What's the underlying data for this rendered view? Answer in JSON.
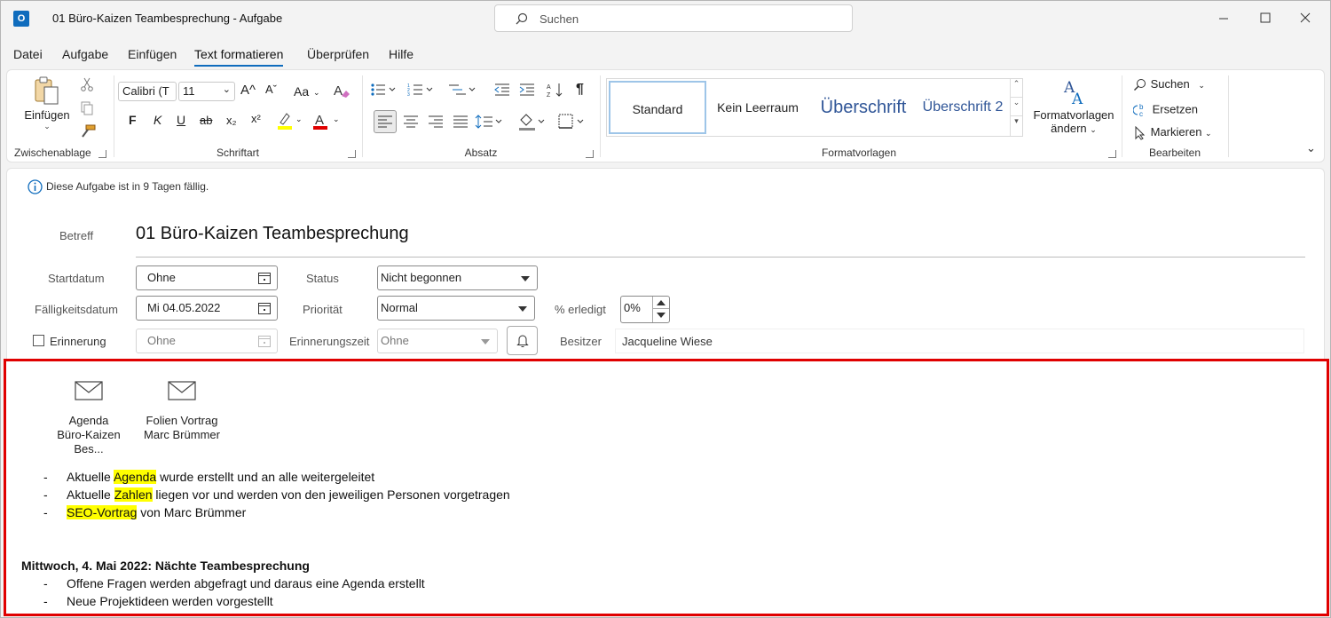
{
  "app": {
    "icon": "outlook-icon",
    "logo_letter": "O"
  },
  "titlebar": {
    "title": "01 Büro-Kaizen Teambesprechung  -  Aufgabe",
    "search_placeholder": "Suchen"
  },
  "menu": {
    "items": [
      "Datei",
      "Aufgabe",
      "Einfügen",
      "Text formatieren",
      "Überprüfen",
      "Hilfe"
    ],
    "active": "Text formatieren"
  },
  "ribbon": {
    "clipboard": {
      "paste_label": "Einfügen",
      "group_label": "Zwischenablage"
    },
    "font": {
      "font_name": "Calibri (T",
      "font_size": "11",
      "group_label": "Schriftart",
      "bold": "F",
      "italic": "K",
      "underline": "U",
      "strike": "ab",
      "sub": "x₂",
      "sup": "x²",
      "grow": "A^",
      "shrink": "Aˇ",
      "case": "Aa",
      "highlight_color": "#ffff00",
      "font_color": "#e00000"
    },
    "paragraph": {
      "group_label": "Absatz",
      "pilcrow": "¶"
    },
    "styles": {
      "items": [
        "Standard",
        "Kein Leerraum",
        "Überschrift",
        "Überschrift 2"
      ],
      "selected": "Standard",
      "change_label_1": "Formatvorlagen",
      "change_label_2": "ändern",
      "group_label": "Formatvorlagen",
      "heading_color": "#2f5597"
    },
    "editing": {
      "find": "Suchen",
      "replace": "Ersetzen",
      "select": "Markieren",
      "group_label": "Bearbeiten"
    }
  },
  "task": {
    "info": "Diese Aufgabe ist in 9 Tagen fällig.",
    "subject_label": "Betreff",
    "subject": "01 Büro-Kaizen Teambesprechung",
    "start_label": "Startdatum",
    "start_value": "Ohne",
    "due_label": "Fälligkeitsdatum",
    "due_value": "Mi 04.05.2022",
    "reminder_label": "Erinnerung",
    "reminder_value": "Ohne",
    "status_label": "Status",
    "status_value": "Nicht begonnen",
    "priority_label": "Priorität",
    "priority_value": "Normal",
    "reminder_time_label": "Erinnerungszeit",
    "reminder_time_value": "Ohne",
    "percent_label": "% erledigt",
    "percent_value": "0%",
    "owner_label": "Besitzer",
    "owner_value": "Jacqueline Wiese"
  },
  "body": {
    "attachments": [
      {
        "line1": "Agenda",
        "line2": "Büro-Kaizen Bes..."
      },
      {
        "line1": "Folien Vortrag",
        "line2": "Marc Brümmer"
      }
    ],
    "list1": [
      {
        "pre": "Aktuelle ",
        "hl": "Agenda",
        "post": " wurde erstellt und an alle weitergeleitet"
      },
      {
        "pre": "Aktuelle ",
        "hl": "Zahlen",
        "post": " liegen vor und werden von den jeweiligen Personen vorgetragen"
      },
      {
        "pre": "",
        "hl": "SEO-Vortrag",
        "post": " von Marc Brümmer"
      }
    ],
    "heading": "Mittwoch, 4. Mai 2022: Nächte Teambesprechung",
    "list2": [
      "Offene Fragen werden abgefragt und daraus eine Agenda erstellt",
      "Neue Projektideen werden vorgestellt"
    ],
    "dash": "-",
    "frame_color": "#e00000"
  }
}
